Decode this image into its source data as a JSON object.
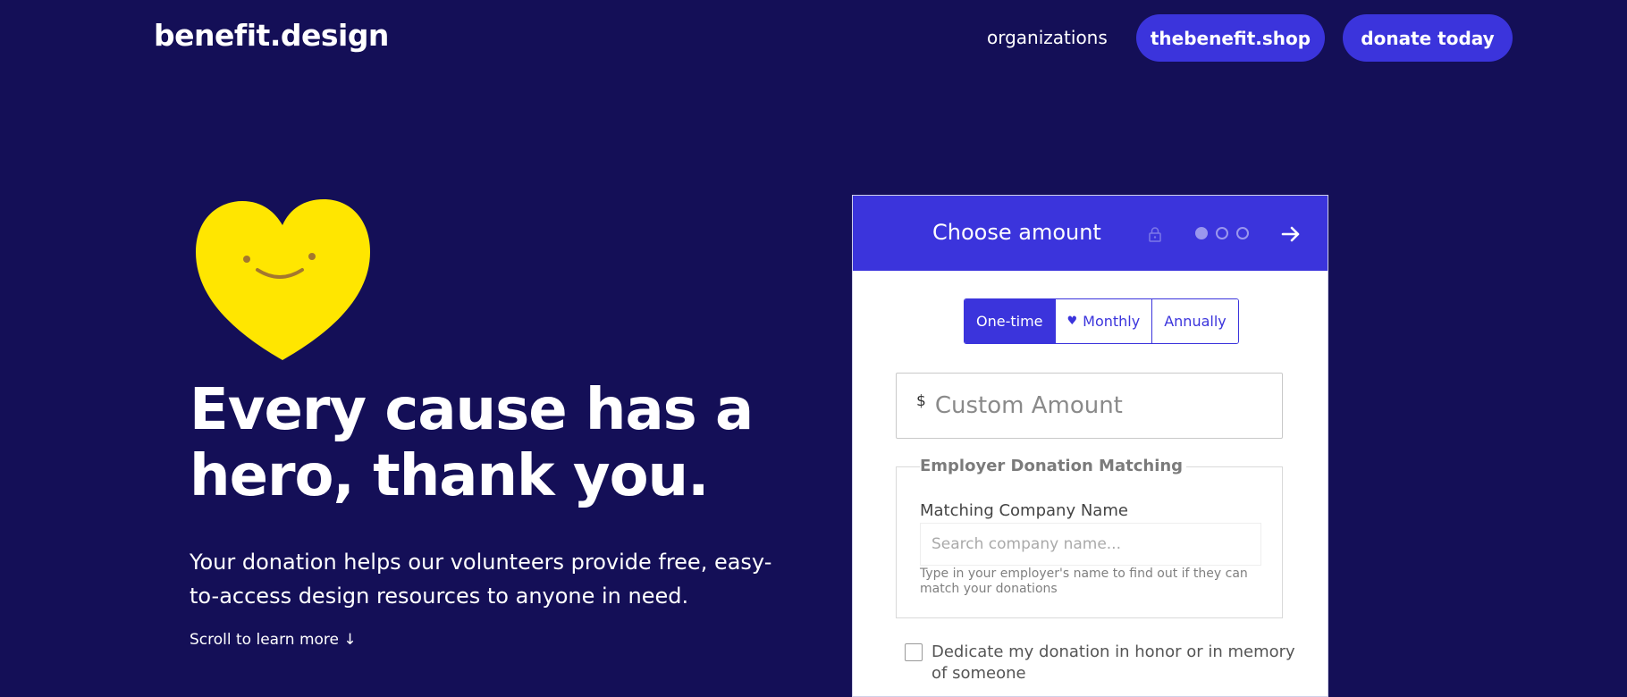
{
  "header": {
    "brand": "benefit.design",
    "nav_organizations": "organizations",
    "shop_button": "thebenefit.shop",
    "donate_button": "donate today"
  },
  "hero": {
    "headline": "Every cause has a hero, thank you.",
    "subtext": "Your donation helps our volunteers provide free, easy-to-access design resources to anyone in need.",
    "scroll_hint": "Scroll to learn more ↓"
  },
  "donation_form": {
    "title": "Choose amount",
    "step_current": 1,
    "step_total": 3,
    "frequency": {
      "options": [
        "One-time",
        "Monthly",
        "Annually"
      ],
      "selected": "One-time"
    },
    "currency_symbol": "$",
    "custom_amount_placeholder": "Custom Amount",
    "matching": {
      "legend": "Employer Donation Matching",
      "company_label": "Matching Company Name",
      "company_placeholder": "Search company name...",
      "help_text": "Type in your employer's name to find out if they can match your donations"
    },
    "dedicate_label": "Dedicate my donation in honor or in memory of someone"
  },
  "colors": {
    "background": "#140f57",
    "accent": "#3b34dc",
    "heart": "#ffe600"
  },
  "icons": {
    "brand_heart": "smiling-heart-icon",
    "lock": "lock-icon",
    "next": "arrow-right-icon",
    "frequency_heart": "heart-icon"
  }
}
